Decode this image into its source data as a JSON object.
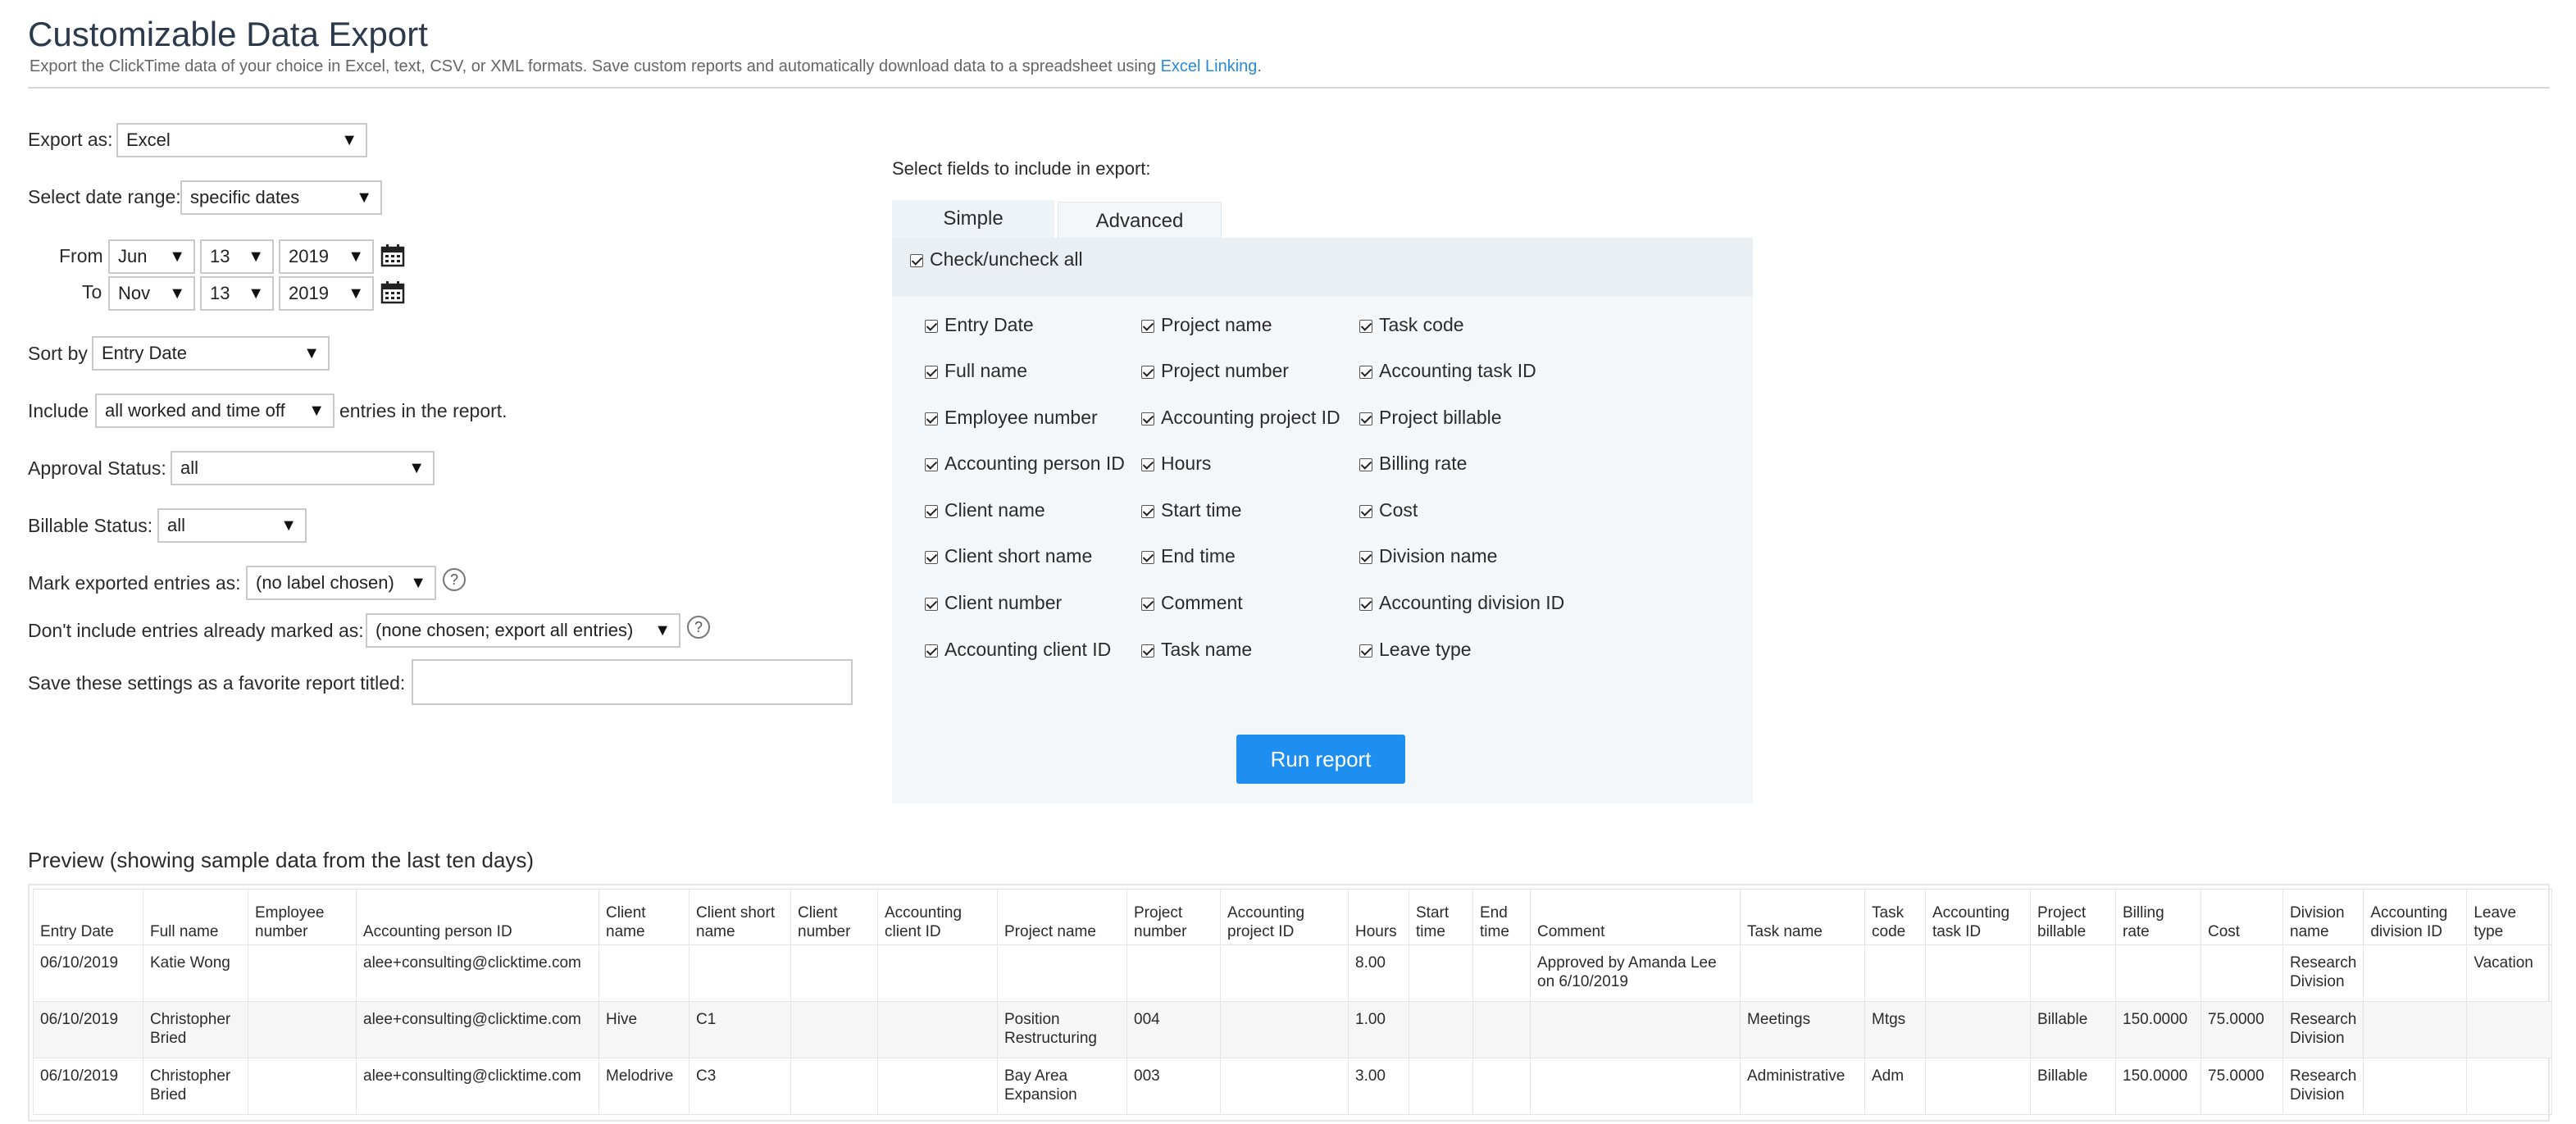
{
  "header": {
    "title": "Customizable Data Export",
    "subtitle": "Export the ClickTime data of your choice in Excel, text, CSV, or XML formats. Save custom reports and automatically download data to a spreadsheet using ",
    "subtitle_link": "Excel Linking",
    "subtitle_end": "."
  },
  "form": {
    "export_as": {
      "label": "Export as:",
      "value": "Excel"
    },
    "date_range": {
      "label": "Select date range:",
      "value": "specific dates"
    },
    "from": {
      "label": "From",
      "month": "Jun",
      "day": "13",
      "year": "2019"
    },
    "to": {
      "label": "To",
      "month": "Nov",
      "day": "13",
      "year": "2019"
    },
    "sort_by": {
      "label": "Sort by",
      "value": "Entry Date"
    },
    "include": {
      "label": "Include",
      "value": "all worked and time off",
      "suffix": "entries in the report."
    },
    "approval": {
      "label": "Approval Status:",
      "value": "all"
    },
    "billable": {
      "label": "Billable Status:",
      "value": "all"
    },
    "mark_exported": {
      "label": "Mark exported entries as:",
      "value": "(no label chosen)"
    },
    "dont_include": {
      "label": "Don't include entries already marked as:",
      "value": "(none chosen; export all entries)"
    },
    "save_favorite": {
      "label": "Save these settings as a favorite report titled:",
      "value": ""
    }
  },
  "fields_panel": {
    "heading": "Select fields to include in export:",
    "tabs": [
      "Simple",
      "Advanced"
    ],
    "check_all_label": "Check/uncheck all",
    "columns": [
      [
        "Entry Date",
        "Full name",
        "Employee number",
        "Accounting person ID",
        "Client name",
        "Client short name",
        "Client number",
        "Accounting client ID"
      ],
      [
        "Project name",
        "Project number",
        "Accounting project ID",
        "Hours",
        "Start time",
        "End time",
        "Comment",
        "Task name"
      ],
      [
        "Task code",
        "Accounting task ID",
        "Project billable",
        "Billing rate",
        "Cost",
        "Division name",
        "Accounting division ID",
        "Leave type"
      ]
    ],
    "run_button": "Run report"
  },
  "preview": {
    "heading": "Preview (showing sample data from the last ten days)",
    "columns": [
      "Entry Date",
      "Full name",
      "Employee number",
      "Accounting person ID",
      "Client name",
      "Client short name",
      "Client number",
      "Accounting client ID",
      "Project name",
      "Project number",
      "Accounting project ID",
      "Hours",
      "Start time",
      "End time",
      "Comment",
      "Task name",
      "Task code",
      "Accounting task ID",
      "Project billable",
      "Billing rate",
      "Cost",
      "Division name",
      "Accounting division ID",
      "Leave type"
    ],
    "rows": [
      [
        "06/10/2019",
        "Katie Wong",
        "",
        "alee+consulting@clicktime.com",
        "",
        "",
        "",
        "",
        "",
        "",
        "",
        "8.00",
        "",
        "",
        "Approved by Amanda Lee on 6/10/2019",
        "",
        "",
        "",
        "",
        "",
        "",
        "Research Division",
        "",
        "Vacation"
      ],
      [
        "06/10/2019",
        "Christopher Bried",
        "",
        "alee+consulting@clicktime.com",
        "Hive",
        "C1",
        "",
        "",
        "Position Restructuring",
        "004",
        "",
        "1.00",
        "",
        "",
        "",
        "Meetings",
        "Mtgs",
        "",
        "Billable",
        "150.0000",
        "75.0000",
        "Research Division",
        "",
        ""
      ],
      [
        "06/10/2019",
        "Christopher Bried",
        "",
        "alee+consulting@clicktime.com",
        "Melodrive",
        "C3",
        "",
        "",
        "Bay Area Expansion",
        "003",
        "",
        "3.00",
        "",
        "",
        "",
        "Administrative",
        "Adm",
        "",
        "Billable",
        "150.0000",
        "75.0000",
        "Research Division",
        "",
        ""
      ]
    ]
  }
}
